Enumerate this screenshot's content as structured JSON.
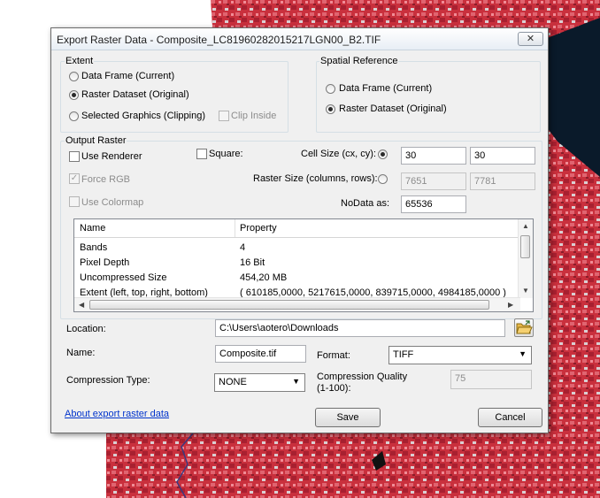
{
  "dialog": {
    "title": "Export Raster Data - Composite_LC81960282015217LGN00_B2.TIF",
    "close_label": "✕"
  },
  "extent": {
    "label": "Extent",
    "data_frame": "Data Frame (Current)",
    "raster_dataset": "Raster Dataset (Original)",
    "selected_graphics": "Selected Graphics (Clipping)",
    "clip_inside": "Clip Inside",
    "selected": "raster_dataset"
  },
  "spatial_reference": {
    "label": "Spatial Reference",
    "data_frame": "Data Frame (Current)",
    "raster_dataset": "Raster Dataset (Original)",
    "selected": "raster_dataset"
  },
  "output_raster": {
    "label": "Output Raster",
    "use_renderer": "Use Renderer",
    "square": "Square:",
    "force_rgb": "Force RGB",
    "use_colormap": "Use Colormap",
    "cell_size_label": "Cell Size (cx, cy):",
    "cell_cx": "30",
    "cell_cy": "30",
    "raster_size_label": "Raster Size (columns, rows):",
    "raster_cols": "7651",
    "raster_rows": "7781",
    "nodata_label": "NoData as:",
    "nodata_value": "65536"
  },
  "properties": {
    "headers": [
      "Name",
      "Property"
    ],
    "rows": [
      {
        "name": "Bands",
        "value": "4"
      },
      {
        "name": "Pixel Depth",
        "value": "16 Bit"
      },
      {
        "name": "Uncompressed Size",
        "value": "454,20 MB"
      },
      {
        "name": "Extent (left, top, right, bottom)",
        "value": "( 610185,0000, 5217615,0000, 839715,0000, 4984185,0000 )"
      }
    ]
  },
  "location": {
    "label": "Location:",
    "value": "C:\\Users\\aotero\\Downloads"
  },
  "name": {
    "label": "Name:",
    "value": "Composite.tif"
  },
  "format": {
    "label": "Format:",
    "value": "TIFF"
  },
  "compression": {
    "type_label": "Compression Type:",
    "type_value": "NONE",
    "quality_label_1": "Compression Quality",
    "quality_label_2": "(1-100):",
    "quality_value": "75"
  },
  "footer": {
    "help_link": "About export raster data",
    "save": "Save",
    "cancel": "Cancel"
  },
  "icons": {
    "close": "close-icon",
    "folder": "open-folder-icon",
    "dropdown": "chevron-down-icon"
  },
  "colors": {
    "raster_red": "#c8323e",
    "link": "#0033cc"
  }
}
